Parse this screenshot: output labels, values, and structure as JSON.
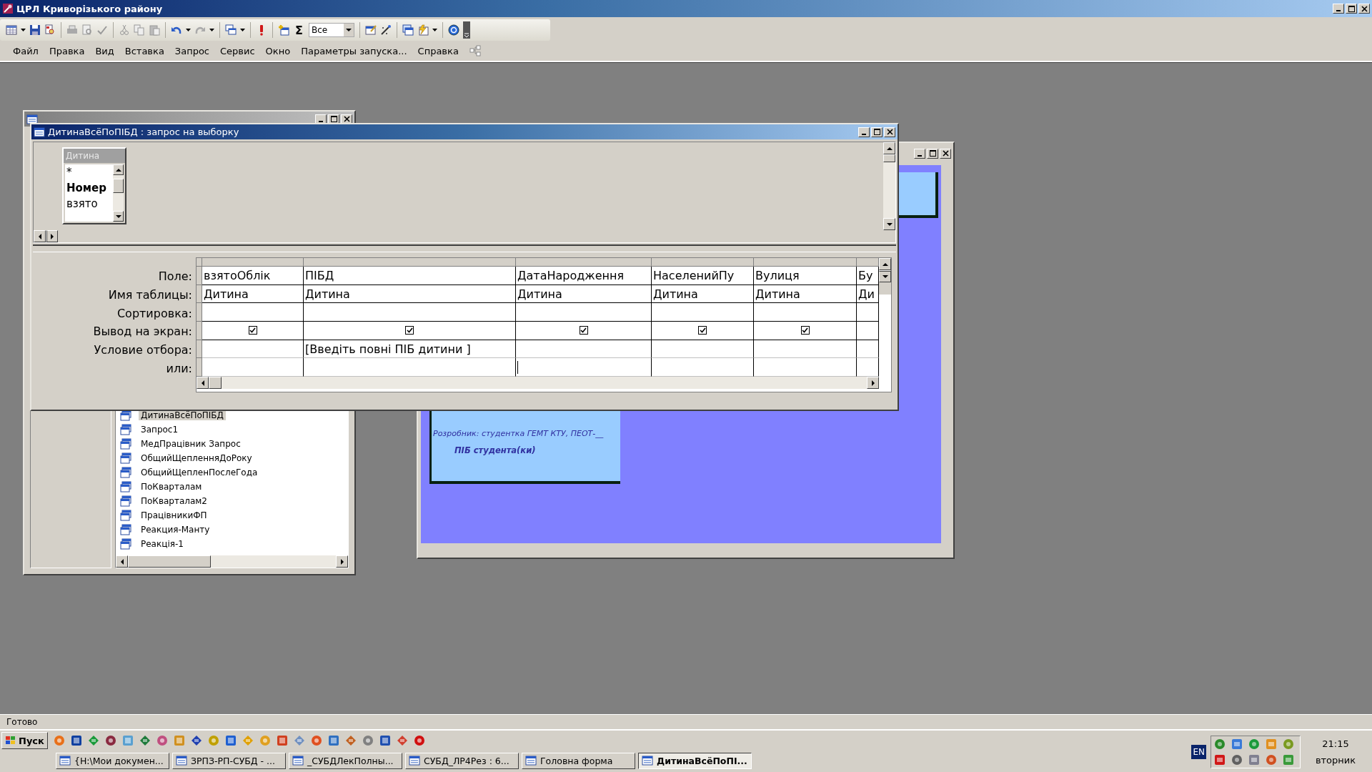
{
  "app_window": {
    "title": "ЦРЛ Криворізького району"
  },
  "toolbar": {
    "totals_label": "Σ",
    "filter_value": "Все"
  },
  "menu": [
    "Файл",
    "Правка",
    "Вид",
    "Вставка",
    "Запрос",
    "Сервис",
    "Окно",
    "Параметры запуска...",
    "Справка"
  ],
  "database_window": {
    "objects": [
      {
        "label": "ДитинаВсёПоПІБД",
        "selected": true
      },
      {
        "label": "Запрос1",
        "selected": false
      },
      {
        "label": "МедПрацівник Запрос",
        "selected": false
      },
      {
        "label": "ОбщийЩепленняДоРоку",
        "selected": false
      },
      {
        "label": "ОбщийЩепленПослеГода",
        "selected": false
      },
      {
        "label": "ПоКварталам",
        "selected": false
      },
      {
        "label": "ПоКварталам2",
        "selected": false
      },
      {
        "label": "ПрацівникиФП",
        "selected": false
      },
      {
        "label": "Реакция-Манту",
        "selected": false
      },
      {
        "label": "Реакція-1",
        "selected": false
      }
    ]
  },
  "form_window": {
    "developer_line": "Розробник: студентка ГЕМТ КТУ, ПЕОТ-__",
    "student_line": "ПІБ студента(ки)"
  },
  "query_window": {
    "title": "ДитинаВсёПоПІБД : запрос на выборку",
    "table": {
      "title": "Дитина",
      "fields": [
        {
          "name": "*",
          "primary_key": false
        },
        {
          "name": "Номер",
          "primary_key": true
        },
        {
          "name": "взято",
          "primary_key": false
        }
      ]
    },
    "row_labels": [
      "Поле:",
      "Имя таблицы:",
      "Сортировка:",
      "Вывод на экран:",
      "Условие отбора:",
      "или:"
    ],
    "columns": [
      {
        "field": "взятоОблік",
        "table": "Дитина",
        "show": true
      },
      {
        "field": "ПІБД",
        "table": "Дитина",
        "show": true,
        "criteria": "[Введіть повні ПІБ дитини ]"
      },
      {
        "field": "ДатаНародження",
        "table": "Дитина",
        "show": true
      },
      {
        "field": "НаселенийПу",
        "table": "Дитина",
        "show": true
      },
      {
        "field": "Вулиця",
        "table": "Дитина",
        "show": true
      },
      {
        "field": "Бу",
        "table": "Ди"
      }
    ]
  },
  "status_bar": {
    "text": "Готово"
  },
  "taskbar": {
    "start_label": "Пуск",
    "tasks": [
      {
        "label": "{H:\\Мои докумен...",
        "selected": false
      },
      {
        "label": "ЗРПЗ-РП-СУБД - ...",
        "selected": false
      },
      {
        "label": "_СУБДЛекПолны...",
        "selected": false
      },
      {
        "label": "СУБД_ЛР4Рез : 6...",
        "selected": false
      },
      {
        "label": "Головна форма",
        "selected": false
      },
      {
        "label": "ДитинаВсёПоПІ...",
        "selected": true
      }
    ],
    "language": "EN",
    "time": "21:15",
    "day": "вторник"
  }
}
